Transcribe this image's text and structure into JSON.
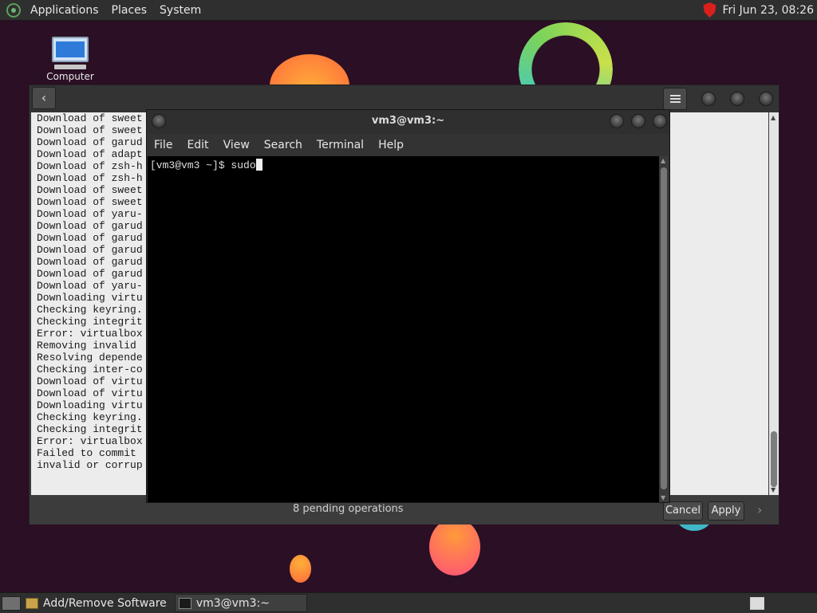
{
  "top_panel": {
    "menus": [
      "Applications",
      "Places",
      "System"
    ],
    "clock": "Fri Jun 23, 08:26"
  },
  "desktop": {
    "icons": [
      {
        "label": "Computer",
        "icon": "computer-icon"
      }
    ]
  },
  "software_window": {
    "log_lines": [
      "Download of sweet",
      "Download of sweet",
      "Download of garud",
      "Download of adapt",
      "Download of zsh-h",
      "Download of zsh-h",
      "Download of sweet",
      "Download of sweet",
      "Download of yaru-",
      "Download of garud",
      "Download of garud",
      "Download of garud",
      "Download of garud",
      "Download of garud",
      "Download of yaru-",
      "Downloading virtu",
      "Checking keyring.",
      "Checking integrit",
      "Error: virtualbox",
      "Removing invalid",
      "Resolving depende",
      "Checking inter-co",
      "Download of virtu",
      "Download of virtu",
      "Downloading virtu",
      "Checking keyring.",
      "Checking integrit",
      "Error: virtualbox",
      "Failed to commit",
      "invalid or corrup"
    ],
    "pending_text": "8 pending operations",
    "cancel_label": "Cancel",
    "apply_label": "Apply"
  },
  "terminal": {
    "title": "vm3@vm3:~",
    "menus": [
      "File",
      "Edit",
      "View",
      "Search",
      "Terminal",
      "Help"
    ],
    "prompt": "[vm3@vm3 ~]$ sudo"
  },
  "taskbar": {
    "tasks": [
      {
        "label": "Add/Remove Software",
        "icon": "package-icon",
        "active": false
      },
      {
        "label": "vm3@vm3:~",
        "icon": "terminal-icon",
        "active": true
      }
    ]
  },
  "colors": {
    "wallpaper": "#2b0f24",
    "terminal_bg": "#000000",
    "log_bg": "#ececec",
    "shield": "#d9201a"
  }
}
